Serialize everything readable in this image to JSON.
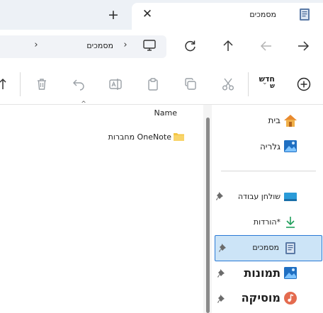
{
  "tab": {
    "title": "מסמכים",
    "close_icon": "close-icon",
    "new_tab_icon": "plus-icon",
    "doc_icon": "documents-icon"
  },
  "address": {
    "crumb": "מסמכים",
    "sep": "›",
    "sep2": "›",
    "pc_icon": "this-pc-icon"
  },
  "toolbar": {
    "new_label_line1": "חדש",
    "new_label_line2": "ש",
    "colors": {
      "icon_gray": "#9aa0a6",
      "accent": "#1f4fa3"
    }
  },
  "list": {
    "sort_caret": "^",
    "column_name": "Name",
    "items": [
      {
        "label": "מחברות OneNote"
      }
    ]
  },
  "nav": {
    "items": [
      {
        "label": "בית",
        "icon": "home-icon"
      },
      {
        "label": "גלריה",
        "icon": "gallery-icon"
      },
      {
        "label": "שולחן עבודה",
        "icon": "desktop-icon",
        "pinned": true
      },
      {
        "label": "הורדות*",
        "icon": "downloads-icon",
        "pinned": true
      },
      {
        "label": "מסמכים",
        "icon": "documents-icon",
        "pinned": true,
        "selected": true
      },
      {
        "label": "תמונות",
        "icon": "pictures-icon",
        "pinned": true
      },
      {
        "label": "מוסיקה",
        "icon": "music-icon",
        "pinned": true
      }
    ]
  }
}
